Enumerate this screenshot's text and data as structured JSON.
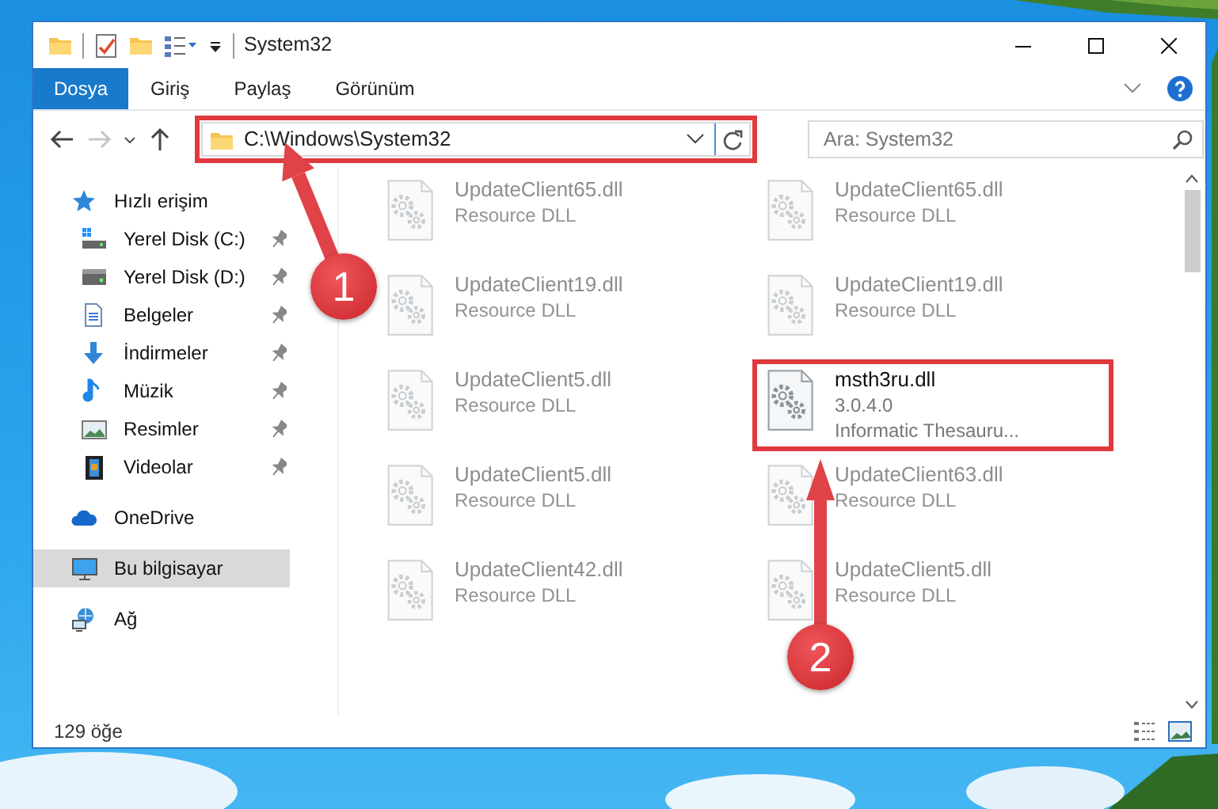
{
  "window": {
    "title": "System32"
  },
  "ribbon_tabs": [
    {
      "label": "Dosya",
      "selected": true
    },
    {
      "label": "Giriş",
      "selected": false
    },
    {
      "label": "Paylaş",
      "selected": false
    },
    {
      "label": "Görünüm",
      "selected": false
    }
  ],
  "address": {
    "path": "C:\\Windows\\System32",
    "highlighted": true
  },
  "search": {
    "placeholder": "Ara: System32"
  },
  "sidebar": {
    "items": [
      {
        "label": "Hızlı erişim",
        "kind": "star",
        "selected": false,
        "children": [
          {
            "label": "Yerel Disk (C:)",
            "kind": "system-drive",
            "pinned": true,
            "selected": false
          },
          {
            "label": "Yerel Disk (D:)",
            "kind": "drive",
            "pinned": true,
            "selected": false
          },
          {
            "label": "Belgeler",
            "kind": "document",
            "pinned": true,
            "selected": false
          },
          {
            "label": "İndirmeler",
            "kind": "download",
            "pinned": true,
            "selected": false
          },
          {
            "label": "Müzik",
            "kind": "music",
            "pinned": true,
            "selected": false
          },
          {
            "label": "Resimler",
            "kind": "pictures",
            "pinned": true,
            "selected": false
          },
          {
            "label": "Videolar",
            "kind": "videos",
            "pinned": true,
            "selected": false
          }
        ]
      },
      {
        "label": "OneDrive",
        "kind": "cloud",
        "selected": false
      },
      {
        "label": "Bu bilgisayar",
        "kind": "computer",
        "selected": true
      },
      {
        "label": "Ağ",
        "kind": "network",
        "selected": false
      }
    ]
  },
  "files": [
    {
      "name": "UpdateClient65.dll",
      "detail": "Resource DLL",
      "highlighted": false
    },
    {
      "name": "UpdateClient65.dll",
      "detail": "Resource DLL",
      "highlighted": false
    },
    {
      "name": "UpdateClient19.dll",
      "detail": "Resource DLL",
      "highlighted": false
    },
    {
      "name": "UpdateClient19.dll",
      "detail": "Resource DLL",
      "highlighted": false
    },
    {
      "name": "UpdateClient5.dll",
      "detail": "Resource DLL",
      "highlighted": false
    },
    {
      "name": "msth3ru.dll",
      "version": "3.0.4.0",
      "detail": "Informatic Thesauru...",
      "highlighted": true
    },
    {
      "name": "UpdateClient5.dll",
      "detail": "Resource DLL",
      "highlighted": false
    },
    {
      "name": "UpdateClient63.dll",
      "detail": "Resource DLL",
      "highlighted": false
    },
    {
      "name": "UpdateClient42.dll",
      "detail": "Resource DLL",
      "highlighted": false
    },
    {
      "name": "UpdateClient5.dll",
      "detail": "Resource DLL",
      "highlighted": false
    }
  ],
  "status_bar": {
    "count": "129 öğe"
  },
  "callouts": [
    {
      "number": "1"
    },
    {
      "number": "2"
    }
  ]
}
